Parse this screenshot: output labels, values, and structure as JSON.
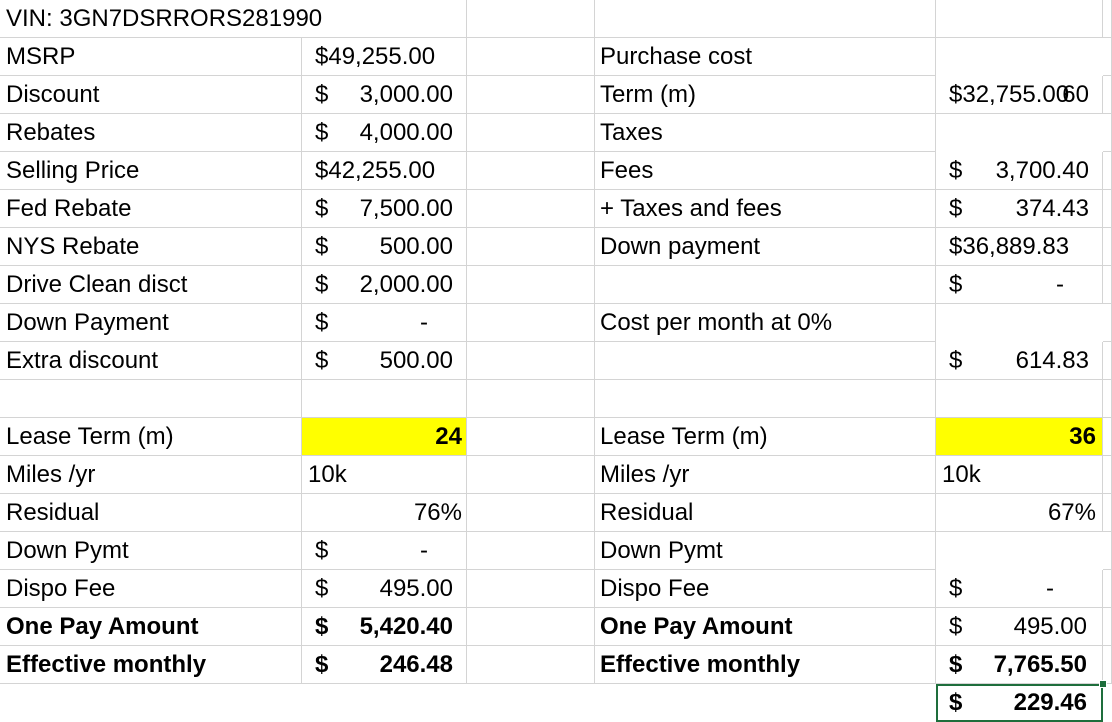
{
  "vin": "VIN: 3GN7DSRRORS281990",
  "purchase": [
    {
      "label": "MSRP",
      "sym": "",
      "amt": "$49,255.00",
      "full": true
    },
    {
      "label": "Discount",
      "sym": "$",
      "amt": "3,000.00"
    },
    {
      "label": "Rebates",
      "sym": "$",
      "amt": "4,000.00"
    },
    {
      "label": "Selling Price",
      "sym": "",
      "amt": "$42,255.00",
      "full": true
    },
    {
      "label": "Fed Rebate",
      "sym": "$",
      "amt": "7,500.00"
    },
    {
      "label": "NYS Rebate",
      "sym": "$",
      "amt": "500.00"
    },
    {
      "label": "Drive Clean disct",
      "sym": "$",
      "amt": "2,000.00"
    },
    {
      "label": "Down Payment",
      "sym": "$",
      "amt": "-"
    },
    {
      "label": "Extra discount",
      "sym": "$",
      "amt": "500.00"
    }
  ],
  "finance": {
    "purchase_cost": {
      "label": "Purchase cost",
      "amt": "$32,755.00"
    },
    "term": {
      "label": "Term (m)",
      "value": "60"
    },
    "taxes": {
      "label": "Taxes",
      "sym": "$",
      "amt": "3,700.40"
    },
    "fees": {
      "label": "Fees",
      "sym": "$",
      "amt": "374.43"
    },
    "plus_taxes": {
      "label": "+ Taxes and fees",
      "amt": "$36,889.83"
    },
    "down": {
      "label": "Down payment",
      "sym": "$",
      "amt": "-"
    },
    "cost_month": {
      "label": "Cost per month at 0%",
      "sym": "$",
      "amt": "614.83"
    }
  },
  "lease_left": {
    "term_label": "Lease Term (m)",
    "term": "24",
    "miles_label": "Miles /yr",
    "miles": "10k",
    "residual_label": "Residual",
    "residual": "76%",
    "down_label": "Down Pymt",
    "down_sym": "$",
    "down": "-",
    "dispo_label": "Dispo Fee",
    "dispo_sym": "$",
    "dispo": "495.00",
    "onepay_label": "One Pay Amount",
    "onepay_sym": "$",
    "onepay": "5,420.40",
    "monthly_label": "Effective monthly",
    "monthly_sym": "$",
    "monthly": "246.48"
  },
  "lease_right": {
    "term_label": "Lease Term (m)",
    "term": "36",
    "miles_label": "Miles /yr",
    "miles": "10k",
    "residual_label": "Residual",
    "residual": "67%",
    "down_label": "Down Pymt",
    "down_sym": "$",
    "down": "-",
    "dispo_label": "Dispo Fee",
    "dispo_sym": "$",
    "dispo": "495.00",
    "onepay_label": "One Pay Amount",
    "onepay_sym": "$",
    "onepay": "7,765.50",
    "monthly_label": "Effective monthly",
    "monthly_sym": "$",
    "monthly": "229.46"
  },
  "colors": {
    "highlight": "#ffff00",
    "selection": "#1e6e3c",
    "gridline": "#d4d4d4"
  }
}
